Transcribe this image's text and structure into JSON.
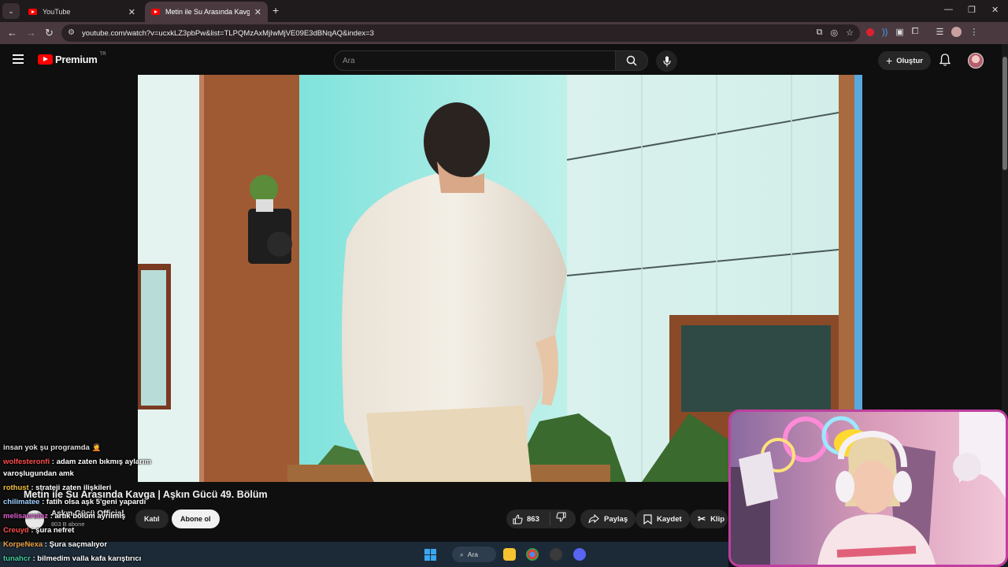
{
  "browser": {
    "tabs": [
      {
        "title": "YouTube",
        "active": false
      },
      {
        "title": "Metin ile Su Arasında Kavga | A",
        "active": true
      }
    ],
    "new_tab_label": "+",
    "url": "youtube.com/watch?v=ucxkLZ3pbPw&list=TLPQMzAxMjIwMjVE09E3dBNqAQ&index=3",
    "window_controls": {
      "minimize": "—",
      "restore": "❐",
      "close": "✕"
    }
  },
  "youtube": {
    "logo_text": "Premium",
    "country": "TR",
    "search_placeholder": "Ara",
    "create_label": "Oluştur"
  },
  "video": {
    "title": "Metin ile Su Arasında Kavga | Aşkın Gücü 49. Bölüm",
    "channel": "Aşkın Gücü Official",
    "subscribers": "803 B abone",
    "join_label": "Katıl",
    "subscribe_label": "Abone ol",
    "likes": "863",
    "share_label": "Paylaş",
    "save_label": "Kaydet",
    "clip_label": "Klip"
  },
  "chat": [
    {
      "user": "",
      "text": "insan yok şu programda 🤦",
      "user_color": "#ffffff"
    },
    {
      "user": "wolfesteronfi",
      "text": " : adam zaten bıkmış aylarım",
      "user_color": "#ff4d4d"
    },
    {
      "user": "",
      "text": "varoşlugundan amk",
      "user_color": "#ffffff"
    },
    {
      "user": "rothust",
      "text": " : strateji zaten ilişkileri",
      "user_color": "#f0c040"
    },
    {
      "user": "chilimatee",
      "text": " : fatih olsa aşk 5'geni yapardı",
      "user_color": "#9fd0ff"
    },
    {
      "user": "melisaersinz",
      "text": " : artık bölüm ayrılmış",
      "user_color": "#e060d0"
    },
    {
      "user": "Creuyd",
      "text": " : şura nefret",
      "user_color": "#ff4d4d"
    },
    {
      "user": "KorpeNexa",
      "text": " : Şura saçmalıyor",
      "user_color": "#f0a040"
    },
    {
      "user": "tunahcr",
      "text": " : bilmedim valla kafa karıştırıcı",
      "user_color": "#40d0a0"
    }
  ],
  "taskbar": {
    "search_label": "Ara"
  },
  "colors": {
    "youtube_red": "#ff0000",
    "background": "#0f0f0f",
    "webcam_border": "#c03fa0"
  }
}
